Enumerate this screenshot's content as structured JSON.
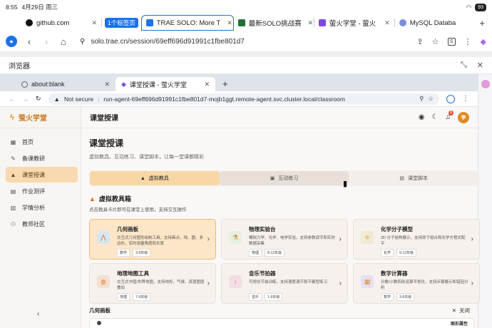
{
  "status": {
    "time": "8:55",
    "date": "4月29日 周三",
    "battery": "93"
  },
  "outer_tabs": [
    {
      "label": "github.com",
      "color": "#111111"
    },
    {
      "label": "1个标签页"
    },
    {
      "label": "TRAE SOLO: More T",
      "color": "#1a73e8",
      "active": true
    },
    {
      "label": "最新SOLO挑战赛",
      "color": "#1f6f3a"
    },
    {
      "label": "萤火学堂 - 萤火",
      "color": "#7b4ae2"
    },
    {
      "label": "MySQL Databa",
      "color": "#7b8cd8"
    }
  ],
  "outer_url": "solo.trae.cn/session/69eff696d91991c1fbe801d7",
  "panel_title": "浏览器",
  "inner_tabs": [
    {
      "label": "about:blank"
    },
    {
      "label": "课堂授课 - 萤火学堂",
      "active": true
    }
  ],
  "inner_url": {
    "not_secure": "Not secure",
    "url": "run-agent-69eff696d91991c1fbe801d7-mojb1ggt.remote-agent.svc.cluster.local/classroom"
  },
  "brand": "萤火学堂",
  "sidebar": [
    {
      "label": "首页",
      "icon": "grid-icon"
    },
    {
      "label": "备课教研",
      "icon": "edit-icon"
    },
    {
      "label": "课堂授课",
      "icon": "cap-icon",
      "active": true
    },
    {
      "label": "作业测评",
      "icon": "clipboard-icon"
    },
    {
      "label": "学情分析",
      "icon": "chart-icon"
    },
    {
      "label": "教师社区",
      "icon": "people-icon"
    }
  ],
  "main_header": {
    "title": "课堂授课",
    "notification_count": "1",
    "user_initial": "李"
  },
  "page": {
    "title": "课堂授课",
    "subtitle": "虚拟教具、互动练习、课堂脚本，让每一堂课都精彩",
    "segments": [
      {
        "label": "虚拟教具",
        "active": true
      },
      {
        "label": "互动练习"
      },
      {
        "label": "课堂脚本"
      }
    ],
    "section_title": "虚拟教具箱",
    "section_sub": "点击教具卡片即可在课堂上使用，支持交互操作"
  },
  "tools": [
    {
      "name": "几何画板",
      "desc": "交互式几何图形绘制工具，支持画点、线、圆、多边形，实时测量角度和长度",
      "tags": [
        "数学",
        "3-9年级"
      ],
      "icon_bg": "#d8e6f2",
      "icon_color": "#c8741a",
      "glyph": "⋀",
      "selected": true
    },
    {
      "name": "物理实验台",
      "desc": "模拟力学、光学、电学实验，支持参数调节和实时数据采集",
      "tags": [
        "物理",
        "8-12年级"
      ],
      "icon_bg": "#e6f0df",
      "icon_color": "#d4772a",
      "glyph": "⚗"
    },
    {
      "name": "化学分子模型",
      "desc": "3D 分子结构展示，支持原子组合和化学方程式配平",
      "tags": [
        "化学",
        "9-12年级"
      ],
      "icon_bg": "#f1ead4",
      "icon_color": "#d4a12a",
      "glyph": "⚛"
    },
    {
      "name": "地理地图工具",
      "desc": "交互式中国/世界地图，支持地形、气候、资源图层叠加",
      "tags": [
        "地理",
        "7-9年级"
      ],
      "icon_bg": "#f4dfd5",
      "icon_color": "#e0802a",
      "glyph": "◍"
    },
    {
      "name": "音乐节拍器",
      "desc": "可视化节拍训练，支持速度调节和节奏型练习",
      "tags": [
        "音乐",
        "1-6年级"
      ],
      "icon_bg": "#f4dde6",
      "icon_color": "#e0902a",
      "glyph": "♪"
    },
    {
      "name": "数字计算器",
      "desc": "分数/小数四则运算可视化，支持步骤展示和错因分析",
      "tags": [
        "数学",
        "3-6年级"
      ],
      "icon_bg": "#e3e0f2",
      "icon_color": "#e0902a",
      "glyph": "▦"
    }
  ],
  "bottom": {
    "title": "几何画板",
    "close_label": "关闭",
    "preview_label": "图形属性"
  }
}
